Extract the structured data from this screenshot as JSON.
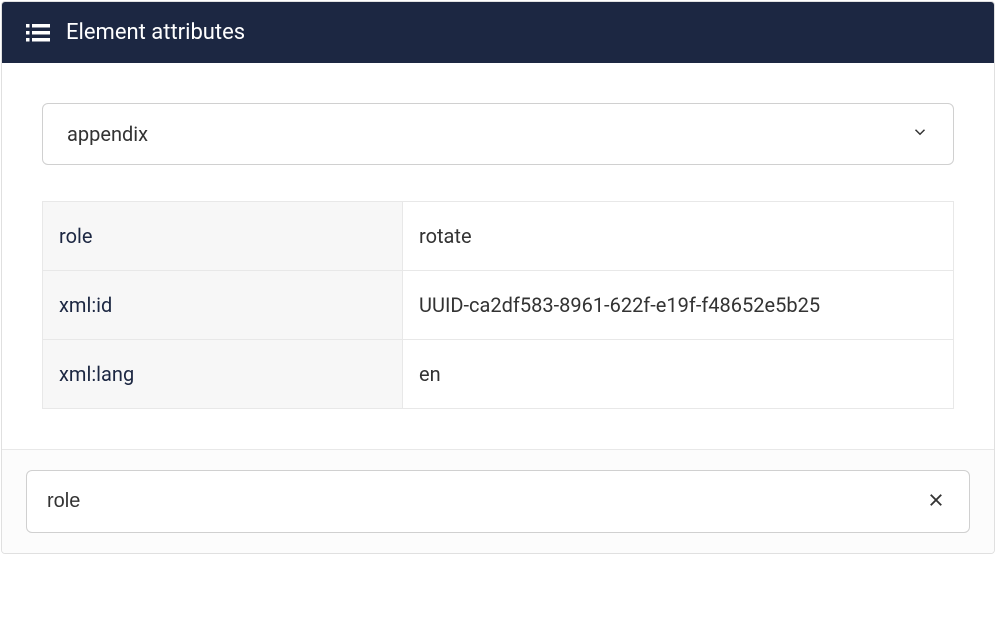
{
  "header": {
    "title": "Element attributes"
  },
  "select": {
    "value": "appendix"
  },
  "attributes": [
    {
      "name": "role",
      "value": "rotate"
    },
    {
      "name": "xml:id",
      "value": "UUID-ca2df583-8961-622f-e19f-f48652e5b25"
    },
    {
      "name": "xml:lang",
      "value": "en"
    }
  ],
  "filter": {
    "value": "role"
  }
}
